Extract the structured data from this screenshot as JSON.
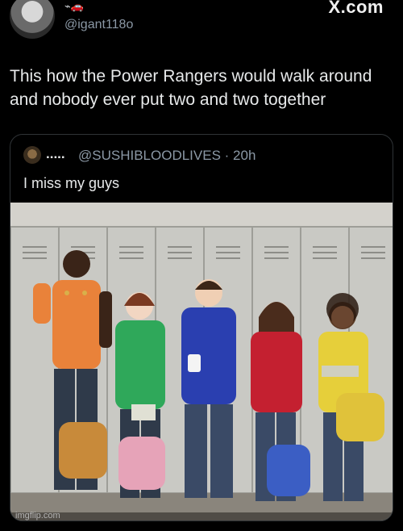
{
  "header": {
    "name_emoji": "⌁🚗",
    "handle": "@igant118o",
    "logo": "X.com"
  },
  "tweet": {
    "text": "This how the Power Rangers would walk around and nobody ever put two and two together"
  },
  "quote": {
    "name": ".....",
    "meta": "@SUSHIBLOODLIVES · 20h",
    "text": "I miss my guys"
  },
  "watermark": "imgflip.com",
  "colors": {
    "background": "#000000",
    "text": "#e7e9ea",
    "muted": "#8b98a5",
    "border": "#2f3336",
    "ranger_red": "#c42030",
    "ranger_blue": "#2a3fb0",
    "ranger_green": "#2fa85a",
    "ranger_yellow": "#e6cf3a",
    "ranger_orange": "#e9823a"
  },
  "icons": {
    "avatar": "profile-avatar",
    "x_logo": "x-logo"
  }
}
